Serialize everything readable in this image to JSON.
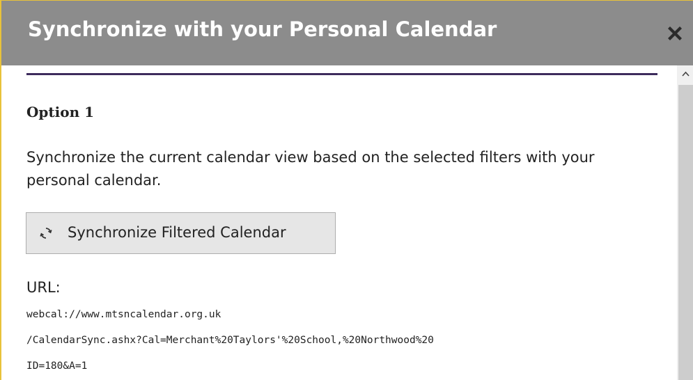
{
  "dialog": {
    "title": "Synchronize with your Personal Calendar",
    "close_icon": "close-icon"
  },
  "option1": {
    "heading": "Option 1",
    "description": "Synchronize the current calendar view based on the selected filters with your personal calendar.",
    "button_label": "Synchronize Filtered Calendar",
    "button_icon": "sync-icon",
    "url_label": "URL:",
    "url_lines": [
      "webcal://www.mtsncalendar.org.uk",
      "/CalendarSync.ashx?Cal=Merchant%20Taylors'%20School,%20Northwood%20",
      "ID=180&A=1"
    ]
  },
  "colors": {
    "titlebar": "#8c8c8c",
    "divider": "#3d2b5c",
    "border_accent": "#e8c23a",
    "button_bg": "#e6e6e6"
  }
}
